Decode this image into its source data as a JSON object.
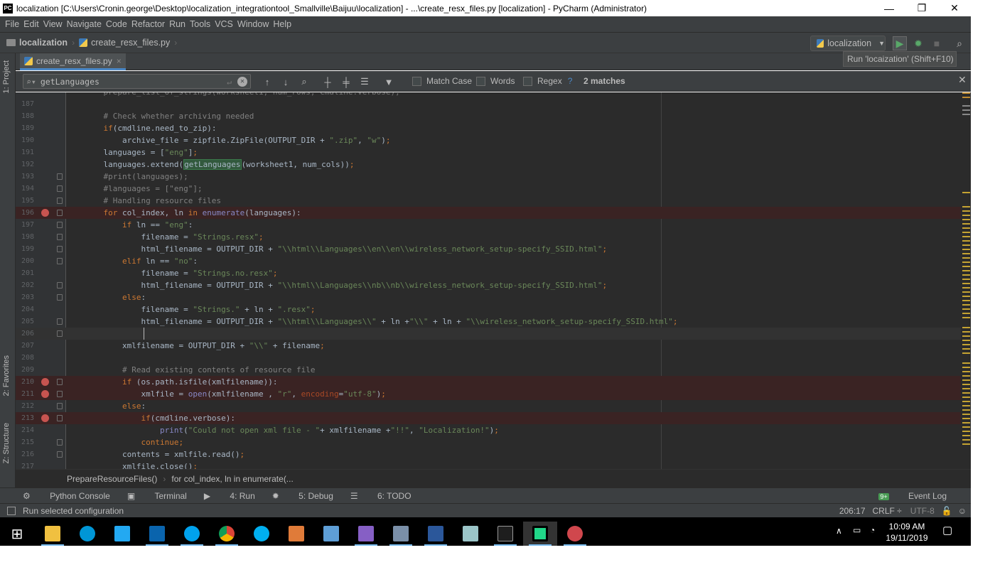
{
  "window": {
    "title": "localization [C:\\Users\\Cronin.george\\Desktop\\localization_integrationtool_Smallville\\Baijuu\\localization] - ...\\create_resx_files.py [localization] - PyCharm (Administrator)",
    "app_icon": "PC"
  },
  "menu": [
    "File",
    "Edit",
    "View",
    "Navigate",
    "Code",
    "Refactor",
    "Run",
    "Tools",
    "VCS",
    "Window",
    "Help"
  ],
  "nav": {
    "project": "localization",
    "file": "create_resx_files.py",
    "run_config": "localization"
  },
  "tooltip": "Run 'locaization' (Shift+F10)",
  "tab": {
    "label": "create_resx_files.py",
    "close": "×"
  },
  "find": {
    "query": "getLanguages",
    "match_case": "Match Case",
    "words": "Words",
    "regex": "Regex",
    "help": "?",
    "matches": "2 matches"
  },
  "side_tabs": {
    "project": "1: Project",
    "favorites": "2: Favorites",
    "structure": "Z: Structure"
  },
  "code_lines": [
    {
      "n": "187",
      "t": ""
    },
    {
      "n": "188",
      "t": "    # Check whether archiving needed"
    },
    {
      "n": "189",
      "t": "    if(cmdline.need_to_zip):"
    },
    {
      "n": "190",
      "t": "        archive_file = zipfile.ZipFile(OUTPUT_DIR + \".zip\", \"w\");"
    },
    {
      "n": "191",
      "t": "    languages = [\"eng\"];"
    },
    {
      "n": "192",
      "t": "    languages.extend(getLanguages(worksheet1, num_cols));"
    },
    {
      "n": "193",
      "t": "    #print(languages);"
    },
    {
      "n": "194",
      "t": "    #languages = [\"eng\"];"
    },
    {
      "n": "195",
      "t": "    # Handling resource files"
    },
    {
      "n": "196",
      "t": "    for col_index, ln in enumerate(languages):"
    },
    {
      "n": "197",
      "t": "        if ln == \"eng\":"
    },
    {
      "n": "198",
      "t": "            filename = \"Strings.resx\";"
    },
    {
      "n": "199",
      "t": "            html_filename = OUTPUT_DIR + \"\\\\html\\\\Languages\\\\en\\\\en\\\\wireless_network_setup-specify_SSID.html\";"
    },
    {
      "n": "200",
      "t": "        elif ln == \"no\":"
    },
    {
      "n": "201",
      "t": "            filename = \"Strings.no.resx\";"
    },
    {
      "n": "202",
      "t": "            html_filename = OUTPUT_DIR + \"\\\\html\\\\Languages\\\\nb\\\\nb\\\\wireless_network_setup-specify_SSID.html\";"
    },
    {
      "n": "203",
      "t": "        else:"
    },
    {
      "n": "204",
      "t": "            filename = \"Strings.\" + ln + \".resx\";"
    },
    {
      "n": "205",
      "t": "            html_filename = OUTPUT_DIR + \"\\\\html\\\\Languages\\\\\" + ln +\"\\\\\" + ln + \"\\\\wireless_network_setup-specify_SSID.html\";"
    },
    {
      "n": "206",
      "t": ""
    },
    {
      "n": "207",
      "t": "        xmlfilename = OUTPUT_DIR + \"\\\\\" + filename;"
    },
    {
      "n": "208",
      "t": ""
    },
    {
      "n": "209",
      "t": "        # Read existing contents of resource file"
    },
    {
      "n": "210",
      "t": "        if (os.path.isfile(xmlfilename)):"
    },
    {
      "n": "211",
      "t": "            xmlfile = open(xmlfilename , \"r\", encoding=\"utf-8\");"
    },
    {
      "n": "212",
      "t": "        else:"
    },
    {
      "n": "213",
      "t": "            if(cmdline.verbose):"
    },
    {
      "n": "214",
      "t": "                print(\"Could not open xml file - \"+ xmlfilename +\"!!\", \"Localization!\");"
    },
    {
      "n": "215",
      "t": "            continue;"
    },
    {
      "n": "216",
      "t": "        contents = xmlfile.read();"
    },
    {
      "n": "217",
      "t": "        xmlfile.close();"
    }
  ],
  "breadcrumb": [
    "PrepareResourceFiles()",
    "for col_index, ln in enumerate(..."
  ],
  "tool_windows": [
    "Python Console",
    "Terminal",
    "4: Run",
    "5: Debug",
    "6: TODO"
  ],
  "event_log": "Event Log",
  "status": {
    "message": "Run selected configuration",
    "position": "206:17",
    "line_sep": "CRLF ÷",
    "encoding": "UTF-8"
  },
  "clock": {
    "time": "10:09 AM",
    "date": "19/11/2019"
  },
  "colors": {
    "bg": "#2b2b2b",
    "panel": "#3c3f41",
    "keyword": "#cc7832",
    "string": "#6a8759",
    "comment": "#808080",
    "breakpoint": "#c75450"
  }
}
